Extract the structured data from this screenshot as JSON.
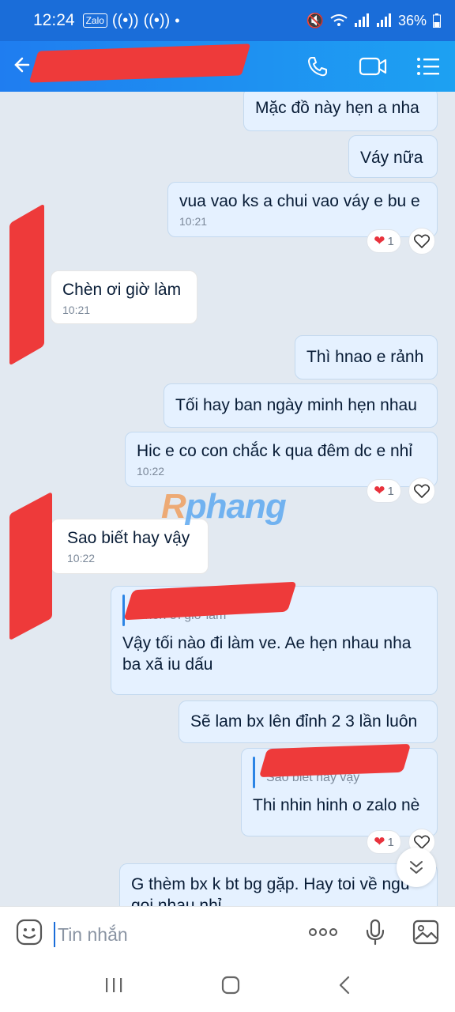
{
  "status_bar": {
    "time": "12:24",
    "app_badge": "Zalo",
    "battery": "36%"
  },
  "header": {
    "contact_name": ""
  },
  "composer": {
    "placeholder": "Tin nhắn"
  },
  "watermark": {
    "text_a": "R",
    "text_b": "phang"
  },
  "messages": [
    {
      "id": "m1",
      "dir": "out",
      "text": "Mặc đồ này hẹn a nha",
      "time": ""
    },
    {
      "id": "m2",
      "dir": "out",
      "text": "Váy nữa",
      "time": ""
    },
    {
      "id": "m3",
      "dir": "out",
      "text": "vua vao ks a chui vao váy e bu e",
      "time": "10:21",
      "reaction_count": "1"
    },
    {
      "id": "m4",
      "dir": "in",
      "text": "Chèn ơi giờ làm",
      "time": "10:21"
    },
    {
      "id": "m5",
      "dir": "out",
      "text": "Thì hnao e rảnh",
      "time": ""
    },
    {
      "id": "m6",
      "dir": "out",
      "text": "Tối hay ban ngày minh hẹn nhau",
      "time": ""
    },
    {
      "id": "m7",
      "dir": "out",
      "text": "Hic e co con chắc k qua đêm dc e nhỉ",
      "time": "10:22",
      "reaction_count": "1"
    },
    {
      "id": "m8",
      "dir": "in",
      "text": "Sao biết hay vậy",
      "time": "10:22"
    },
    {
      "id": "m9",
      "dir": "out",
      "quote": "Chèn ơi giờ làm",
      "text": "Vậy tối nào đi làm ve. Ae hẹn nhau nha ba xã iu dấu",
      "time": ""
    },
    {
      "id": "m10",
      "dir": "out",
      "text": "Sẽ lam bx lên đỉnh 2 3 lần luôn",
      "time": ""
    },
    {
      "id": "m11",
      "dir": "out",
      "quote": "Sao biết hay vậy",
      "text": "Thi nhin hinh o zalo nè",
      "time": "",
      "reaction_count": "1"
    },
    {
      "id": "m12",
      "dir": "out",
      "text": "G thèm bx k bt bg gặp. Hay toi về ngủ goi nhau nhỉ",
      "time": ""
    }
  ],
  "colors": {
    "header_start": "#1f7df0",
    "header_end": "#1da1f2",
    "outgoing_bubble": "#e5f1ff",
    "incoming_bubble": "#ffffff",
    "chat_bg": "#e2e9f1",
    "redaction": "#ee3a3a",
    "heart": "#e8323c"
  },
  "icons": {
    "back": "arrow-left-icon",
    "call": "phone-icon",
    "video": "video-camera-icon",
    "menu": "list-menu-icon",
    "sticker": "emoji-sticker-icon",
    "more": "more-dots-icon",
    "mic": "microphone-icon",
    "image": "image-gallery-icon",
    "scroll": "double-chevron-down-icon"
  }
}
